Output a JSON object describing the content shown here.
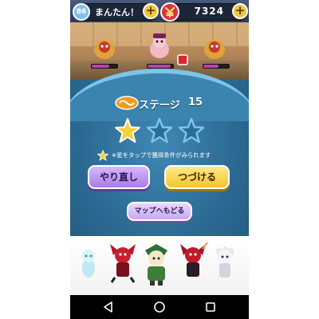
{
  "status_bar": {
    "level": "86",
    "stamina_text": "まんたん！",
    "money": "7324",
    "plus_symbol": "+"
  },
  "stage": {
    "label": "ステージ",
    "number": "15",
    "stars_total": 3,
    "stars_earned": 1
  },
  "hint_text": "※星をタップで獲得条件がみられます",
  "buttons": {
    "retry": "やり直し",
    "continue": "つづける",
    "to_map": "マップへもどる"
  },
  "enemies_hp": [
    0.7,
    0.9,
    0.6
  ],
  "colors": {
    "star_gold": "#f6d13b",
    "star_empty": "#2c6d98",
    "panel_blue": "#2c6a93",
    "hp_bar": "#c23db0"
  },
  "icons": {
    "money": "money-icon",
    "nav_back": "back-triangle-icon",
    "nav_home": "home-circle-icon",
    "nav_recent": "recent-square-icon"
  }
}
